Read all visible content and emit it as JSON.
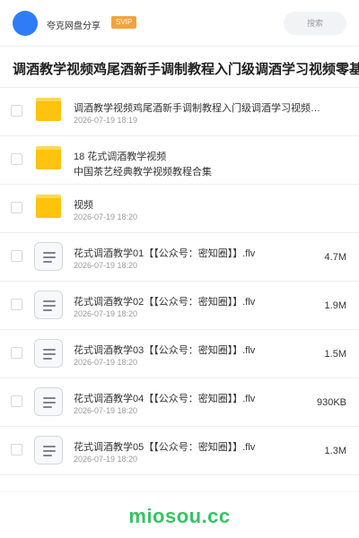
{
  "header": {
    "brand": "夸克网盘分享",
    "badge": "SVIP",
    "search_label": "搜索"
  },
  "page_title": "调酒教学视频鸡尾酒新手调制教程入门级调酒学习视频零基础",
  "colors": {
    "accent_blue": "#2f7cf6",
    "svip_orange": "#f7a23b",
    "folder_yellow": "#ffc20e",
    "watermark_green": "#35c463"
  },
  "items": [
    {
      "type": "folder",
      "icon": "folder-icon",
      "name": "调酒教学视频鸡尾酒新手调制教程入门级调酒学习视频零基础",
      "date": "2026-07-19 18:19",
      "size": ""
    },
    {
      "type": "folder",
      "icon": "folder-icon",
      "name": "18  花式调酒教学视频",
      "subname": "中国茶艺经典教学视频教程合集",
      "date": "",
      "size": ""
    },
    {
      "type": "folder",
      "icon": "folder-icon",
      "name": "视频",
      "date": "2026-07-19 18:20",
      "size": ""
    },
    {
      "type": "file",
      "icon": "document-icon",
      "name": "花式调酒教学01【【公众号：密知圈】】.flv",
      "date": "2026-07-19 18:20",
      "size": "4.7M"
    },
    {
      "type": "file",
      "icon": "document-icon",
      "name": "花式调酒教学02【【公众号：密知圈】】.flv",
      "date": "2026-07-19 18:20",
      "size": "1.9M"
    },
    {
      "type": "file",
      "icon": "document-icon",
      "name": "花式调酒教学03【【公众号：密知圈】】.flv",
      "date": "2026-07-19 18:20",
      "size": "1.5M"
    },
    {
      "type": "file",
      "icon": "document-icon",
      "name": "花式调酒教学04【【公众号：密知圈】】.flv",
      "date": "2026-07-19 18:20",
      "size": "930KB"
    },
    {
      "type": "file",
      "icon": "document-icon",
      "name": "花式调酒教学05【【公众号：密知圈】】.flv",
      "date": "2026-07-19 18:20",
      "size": "1.3M"
    }
  ],
  "footer": {
    "watermark": "miosou.cc"
  }
}
